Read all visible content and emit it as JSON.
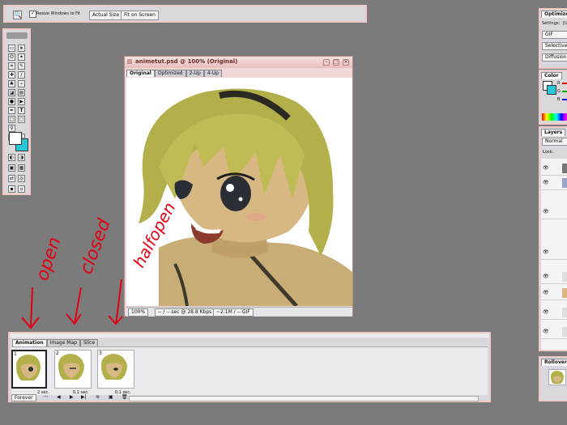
{
  "options_bar": {
    "resize_checkbox_label": "Resize Windows to Fit",
    "actual_size_label": "Actual Size",
    "fit_on_screen_label": "Fit on Screen"
  },
  "document": {
    "title": "animetut.psd @ 100% (Original)",
    "tabs": [
      "Original",
      "Optimized",
      "2-Up",
      "4-Up"
    ],
    "zoom": "100%",
    "download_time": "-- / -- sec @ 28.8 Kbps",
    "file_info": "~2.1M / -- GIF"
  },
  "annotations": {
    "open": "open",
    "closed": "closed",
    "halfopen": "halfopen"
  },
  "animation_palette": {
    "tabs": [
      "Animation",
      "Image Map",
      "Slice"
    ],
    "frames": [
      {
        "number": "1",
        "delay": "2 sec."
      },
      {
        "number": "2",
        "delay": "0.1 sec."
      },
      {
        "number": "3",
        "delay": "0.1 sec."
      }
    ],
    "loop": "Forever"
  },
  "right_panels": {
    "optimize_title": "Optimize",
    "settings_label": "Settings:",
    "settings_value": "[U",
    "format": "GIF",
    "reduction": "Selective",
    "dither": "Diffusion",
    "color_tab": "Color",
    "channels": [
      "R",
      "G",
      "B"
    ],
    "layers_tab": "Layers",
    "blend_mode": "Normal",
    "lock_label": "Lock:",
    "rollovers_tab": "Rollovers"
  },
  "colors": {
    "background": "#7b7b7b",
    "panel": "#d8d8dd",
    "frame_pink": "#f0c8c8",
    "annotation_red": "#e30014",
    "hair": "#b7b34a",
    "skin": "#d2b17d"
  }
}
